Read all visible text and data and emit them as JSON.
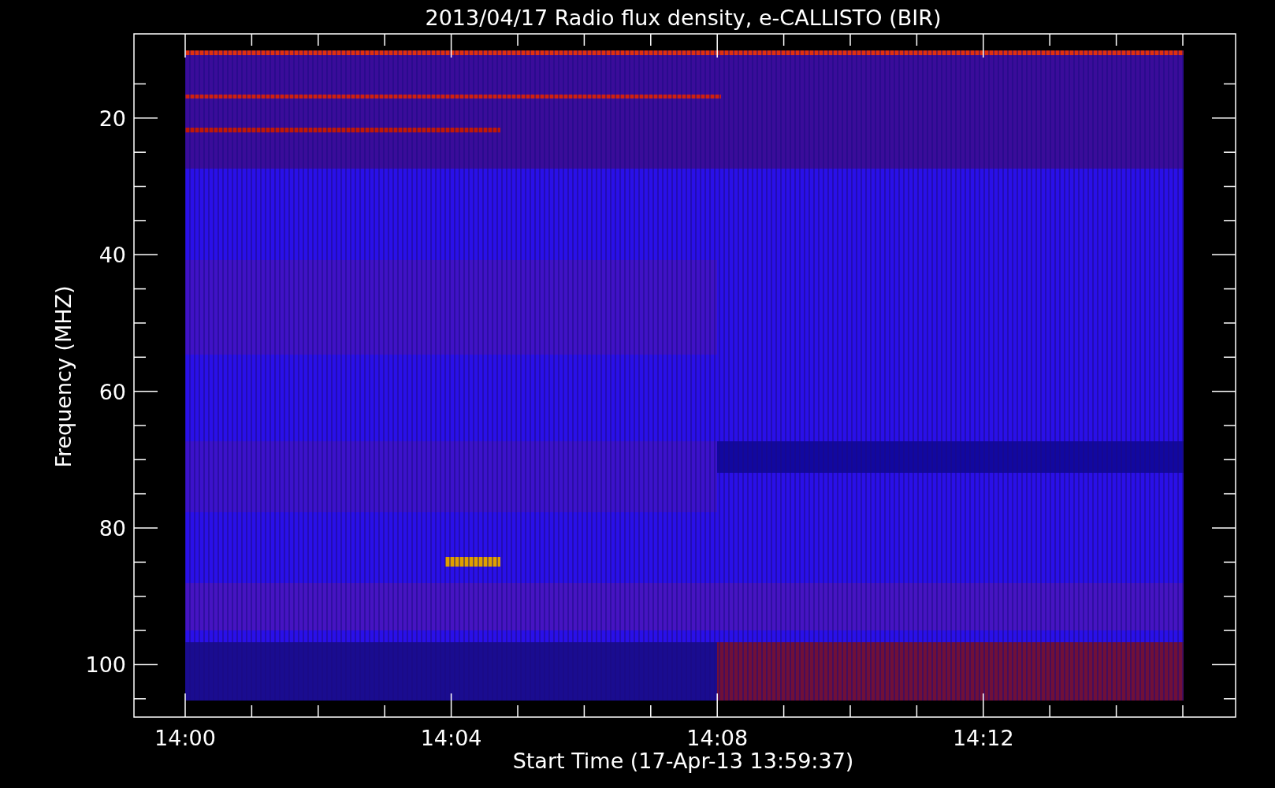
{
  "title": "2013/04/17  Radio flux density, e-CALLISTO (BIR)",
  "ylabel": "Frequency (MHZ)",
  "xlabel": "Start Time (17-Apr-13 13:59:37)",
  "yticks": [
    "20",
    "40",
    "60",
    "80",
    "100"
  ],
  "xticks": [
    "14:00",
    "14:04",
    "14:08",
    "14:12"
  ]
}
